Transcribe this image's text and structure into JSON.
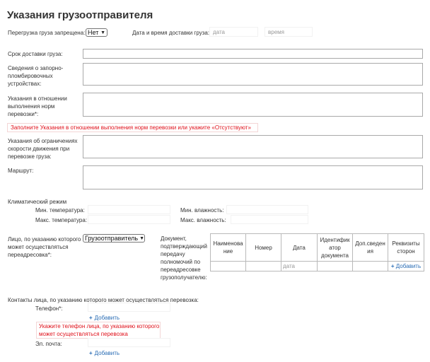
{
  "page_title": "Указания грузоотправителя",
  "reload": {
    "label": "Перегрузка груза запрещена:",
    "value": "Нет"
  },
  "delivery_datetime": {
    "label": "Дата и время доставки груза:",
    "date_placeholder": "дата",
    "time_placeholder": "время"
  },
  "delivery_term": {
    "label": "Срок доставки груза:"
  },
  "seal_info": {
    "label_lines": [
      "Сведения о запорно-",
      "пломбировочных",
      "устройствах:"
    ]
  },
  "norms": {
    "label_lines": [
      "Указания в отношении",
      "выполнения норм",
      "перевозки*:"
    ],
    "error": "Заполните Указания в отношении выполнения норм перевозки или укажите «Отсутствуют»"
  },
  "speed": {
    "label_lines": [
      "Указания об ограничениях",
      "скорости движения при",
      "перевозке груза:"
    ]
  },
  "route": {
    "label": "Маршрут:"
  },
  "climate": {
    "heading": "Климатический режим",
    "min_temp": "Мин. температура:",
    "max_temp": "Макс. температура:",
    "min_humidity": "Мин. влажность:",
    "max_humidity": "Макс. влажность:"
  },
  "redirect": {
    "label_lines": [
      "Лицо, по указанию которого",
      "может осуществляться",
      "переадресовка*:"
    ],
    "value": "Грузоотправитель",
    "doc_label_lines": [
      "Документ,",
      "подтверждающий",
      "передачу",
      "полномочий по",
      "переадресовке",
      "грузополучателю:"
    ],
    "columns": [
      [
        "Наименова",
        "ние"
      ],
      [
        "Номер"
      ],
      [
        "Дата"
      ],
      [
        "Идентифик",
        "атор",
        "документа"
      ],
      [
        "Доп.сведен",
        "ия"
      ],
      [
        "Реквизиты",
        "сторон"
      ]
    ],
    "date_placeholder": "дата",
    "add_label": "Добавить"
  },
  "contacts": {
    "heading": "Контакты лица, по указанию которого может осуществляться перевозка:",
    "phone_label": "Телефон*:",
    "add_label": "Добавить",
    "phone_error_lines": [
      "Укажите телефон лица, по указанию которого",
      "может осуществляться перевозка"
    ],
    "email_label": "Эл. почта:",
    "add_label_2": "Добавить"
  },
  "colors": {
    "error": "#e0101a",
    "link": "#2a6db5",
    "border": "#a9a9a9"
  }
}
